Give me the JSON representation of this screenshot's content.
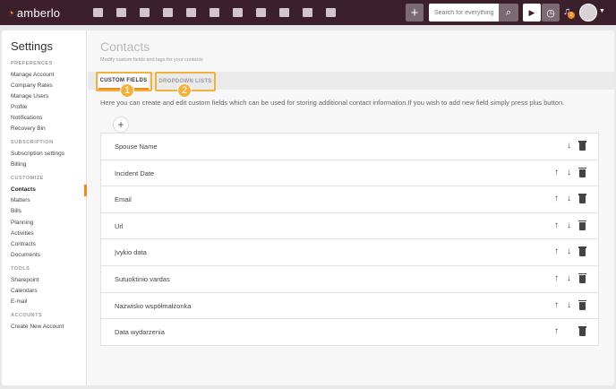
{
  "app": {
    "logo_text": "amberlo"
  },
  "topbar": {
    "nav_icons": [
      "dashboard-icon",
      "contacts-icon",
      "briefcase-icon",
      "bill-icon",
      "bank-icon",
      "calendar-icon",
      "history-icon",
      "folder-icon",
      "document-icon",
      "mail-icon",
      "report-icon"
    ],
    "add_label": "+",
    "search": {
      "placeholder": "Search for everything..."
    },
    "notification_count": "2"
  },
  "sidebar": {
    "title": "Settings",
    "sections": {
      "preferences": "PREFERENCES",
      "subscription": "SUBSCRIPTION",
      "customize": "CUSTOMIZE",
      "tools": "TOOLS",
      "accounts": "ACCOUNTS"
    },
    "items": {
      "manage_account": "Manage Account",
      "company_rates": "Company Rates",
      "manage_users": "Manage Users",
      "profile": "Profile",
      "notifications": "Notifications",
      "recovery_bin": "Recovery Bin",
      "subscription_settings": "Subscription settings",
      "billing": "Billing",
      "contacts": "Contacts",
      "matters": "Matters",
      "bills": "Bills",
      "planning": "Planning",
      "activities": "Activities",
      "contracts": "Contracts",
      "documents": "Documents",
      "sharepoint": "Sharepoint",
      "calendars": "Calendars",
      "email": "E-mail",
      "create_new_account": "Create New Account"
    }
  },
  "main": {
    "title": "Contacts",
    "subtitle": "Modify custom fields and tags for your contacts",
    "tabs": {
      "custom_fields": "CUSTOM FIELDS",
      "dropdown_lists": "DROPDOWN LISTS"
    },
    "callouts": {
      "one": "1",
      "two": "2"
    },
    "intro": "Here you can create and edit custom fields which can be used for storing additional contact information.If you wish to add new field simply press plus button.",
    "add_label": "+",
    "fields": [
      {
        "name": "Spouse Name"
      },
      {
        "name": "Incident Date"
      },
      {
        "name": "Email"
      },
      {
        "name": "Url"
      },
      {
        "name": "Įvykio data"
      },
      {
        "name": "Sutuoktinio vardas"
      },
      {
        "name": "Nazwisko współmałżonka"
      },
      {
        "name": "Data wydarzenia"
      }
    ]
  },
  "colors": {
    "topbar": "#3b1f2b",
    "accent": "#f08a1c",
    "highlight": "#f2b13c"
  }
}
